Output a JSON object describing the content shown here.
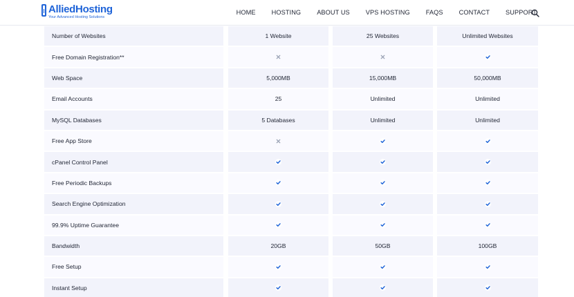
{
  "brand": {
    "name": "AlliedHosting",
    "tagline": "Your Advanced Hosting Solutions",
    "color": "#1e63d8"
  },
  "nav": {
    "items": [
      "HOME",
      "HOSTING",
      "ABOUT US",
      "VPS HOSTING",
      "FAQS",
      "CONTACT",
      "SUPPORT"
    ],
    "search_icon": "search-icon"
  },
  "colors": {
    "check": "#1e63d8",
    "cross": "#9aa3b5",
    "row_shade": "#f2f3fb",
    "row_light": "#fafaff"
  },
  "features": [
    {
      "label": "Number of Websites",
      "values": [
        "1 Website",
        "25 Websites",
        "Unlimited Websites"
      ]
    },
    {
      "label": "Free Domain Registration**",
      "values": [
        "cross",
        "cross",
        "check"
      ]
    },
    {
      "label": "Web Space",
      "values": [
        "5,000MB",
        "15,000MB",
        "50,000MB"
      ]
    },
    {
      "label": "Email Accounts",
      "values": [
        "25",
        "Unlimited",
        "Unlimited"
      ]
    },
    {
      "label": "MySQL Databases",
      "values": [
        "5 Databases",
        "Unlimited",
        "Unlimited"
      ]
    },
    {
      "label": "Free App Store",
      "values": [
        "cross",
        "check",
        "check"
      ]
    },
    {
      "label": "cPanel Control Panel",
      "values": [
        "check",
        "check",
        "check"
      ]
    },
    {
      "label": "Free Periodic Backups",
      "values": [
        "check",
        "check",
        "check"
      ]
    },
    {
      "label": "Search Engine Optimization",
      "values": [
        "check",
        "check",
        "check"
      ]
    },
    {
      "label": "99.9% Uptime Guarantee",
      "values": [
        "check",
        "check",
        "check"
      ]
    },
    {
      "label": "Bandwidth",
      "values": [
        "20GB",
        "50GB",
        "100GB"
      ]
    },
    {
      "label": "Free Setup",
      "values": [
        "check",
        "check",
        "check"
      ]
    },
    {
      "label": "Instant Setup",
      "values": [
        "check",
        "check",
        "check"
      ]
    }
  ]
}
